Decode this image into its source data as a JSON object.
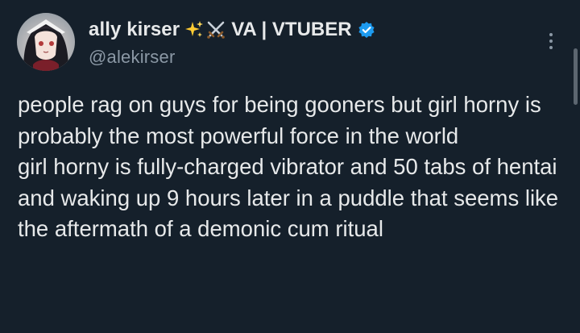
{
  "author": {
    "display_name": "ally kirser",
    "name_suffix": "VA | VTUBER",
    "handle": "@alekirser",
    "emoji": [
      "sparkles-icon",
      "crossed-swords-icon"
    ],
    "verified": true
  },
  "post": {
    "paragraphs": [
      "people rag on guys for being gooners but girl horny is probably the most powerful force in the world",
      "girl horny is fully-charged vibrator and 50 tabs of hentai and waking up 9 hours later in a puddle that seems like the aftermath of a demonic cum ritual"
    ]
  },
  "colors": {
    "background": "#15202b",
    "text": "#e7e9ea",
    "secondary": "#8b98a5",
    "verified": "#1d9bf0"
  },
  "icons": {
    "more": "more-options-icon",
    "verified": "verified-badge-icon"
  }
}
